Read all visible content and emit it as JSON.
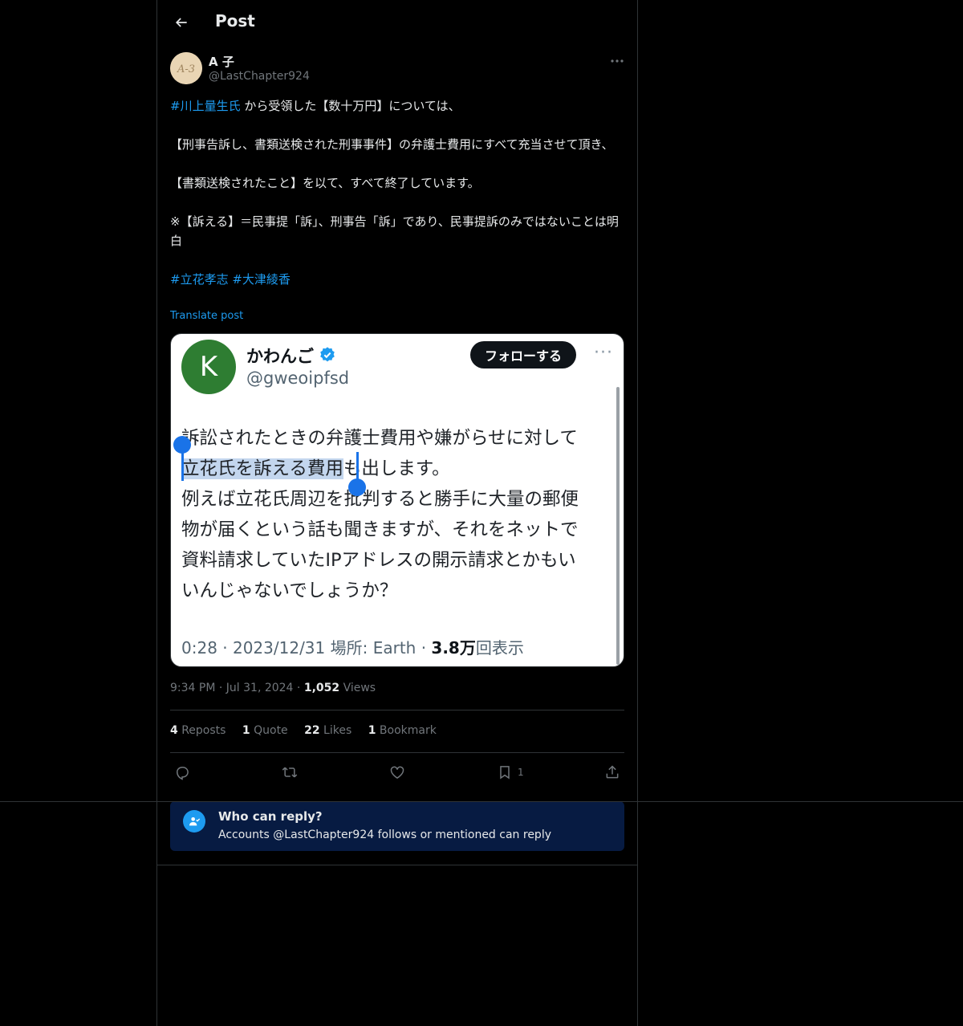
{
  "header": {
    "title": "Post"
  },
  "author": {
    "name": "A 子",
    "handle": "@LastChapter924",
    "avatar_text": "A-3"
  },
  "tweet": {
    "line1_link": "#川上量生氏",
    "line1_rest": " から受領した【数十万円】については、",
    "para2": "【刑事告訴し、書類送検された刑事事件】の弁護士費用にすべて充当させて頂き、",
    "para3": "【書類送検されたこと】を以て、すべて終了しています。",
    "para4": "※【訴える】＝民事提「訴」、刑事告「訴」であり、民事提訴のみではないことは明白",
    "hashtag1": "#立花孝志",
    "hashtag2": "#大津綾香",
    "translate": "Translate post"
  },
  "embedded_screenshot": {
    "avatar_letter": "K",
    "name": "かわんご",
    "handle": "@gweoipfsd",
    "follow_label": "フォローする",
    "more": "···",
    "line1": "訴訟されたときの弁護士費用や嫌がらせに対して",
    "line2_selected": "立花氏を訴える費用",
    "line2_rest": "も出します。",
    "line3": "例えば立花氏周辺を批判すると勝手に大量の郵便",
    "line4": "物が届くという話も聞きますが、それをネットで",
    "line5": "資料請求していたIPアドレスの開示請求とかもい",
    "line6": "いんじゃないでしょうか？",
    "meta_prefix": "0:28 · 2023/12/31 場所: Earth · ",
    "meta_views": "3.8万",
    "meta_suffix": "回表示"
  },
  "meta": {
    "time": "9:34 PM",
    "sep1": " · ",
    "date": "Jul 31, 2024",
    "sep2": " · ",
    "views_count": "1,052",
    "views_label": " Views"
  },
  "stats": {
    "reposts_count": "4",
    "reposts_label": " Reposts",
    "quote_count": "1",
    "quote_label": " Quote",
    "likes_count": "22",
    "likes_label": " Likes",
    "bookmark_count": "1",
    "bookmark_label": " Bookmark"
  },
  "actions": {
    "bookmark_count": "1"
  },
  "icons": [
    "back-arrow-icon",
    "more-icon",
    "reply-icon",
    "repost-icon",
    "like-icon",
    "bookmark-icon",
    "share-icon",
    "who-can-reply-icon",
    "verified-badge-icon"
  ],
  "reply_settings": {
    "title": "Who can reply?",
    "subtitle": "Accounts @LastChapter924 follows or mentioned can reply"
  },
  "colors": {
    "background": "#000000",
    "accent": "#1d9bf0",
    "text": "#e7e9ea",
    "muted": "#71767b",
    "banner": "#071b42"
  }
}
